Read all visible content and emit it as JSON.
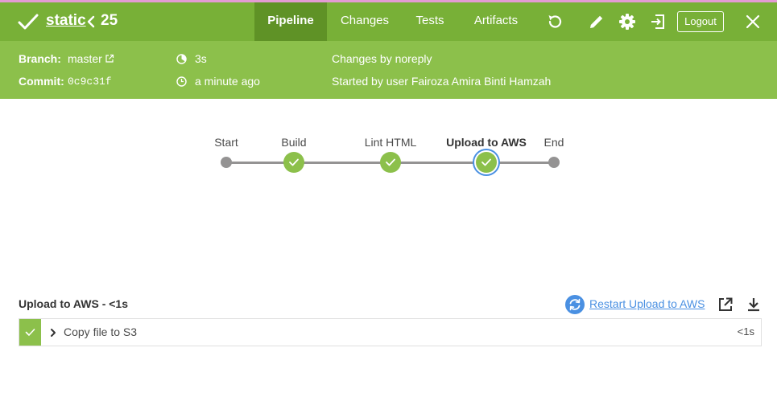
{
  "header": {
    "job_name": "static",
    "run_number": "25",
    "tabs": [
      {
        "label": "Pipeline",
        "active": true
      },
      {
        "label": "Changes",
        "active": false
      },
      {
        "label": "Tests",
        "active": false
      },
      {
        "label": "Artifacts",
        "active": false
      }
    ],
    "logout_label": "Logout",
    "icons": [
      "check-icon",
      "chevron-left-icon",
      "rerun-icon",
      "edit-icon",
      "gear-icon",
      "exit-classic-icon",
      "close-icon"
    ]
  },
  "run_info": {
    "branch_label": "Branch:",
    "branch_value": "master",
    "commit_label": "Commit:",
    "commit_value": "0c9c31f",
    "duration": "3s",
    "time_ago": "a minute ago",
    "changes": "Changes by noreply",
    "started_by": "Started by user Fairoza Amira Binti Hamzah"
  },
  "pipeline": {
    "stages": [
      {
        "label": "Start",
        "status": "none"
      },
      {
        "label": "Build",
        "status": "success"
      },
      {
        "label": "Lint HTML",
        "status": "success"
      },
      {
        "label": "Upload to AWS",
        "status": "success",
        "selected": true
      },
      {
        "label": "End",
        "status": "none"
      }
    ]
  },
  "detail": {
    "title": "Upload to AWS - <1s",
    "restart_label": "Restart Upload to AWS",
    "steps": [
      {
        "name": "Copy file to S3",
        "duration": "<1s",
        "status": "success"
      }
    ]
  },
  "colors": {
    "header_bg": "#78b037",
    "subheader_bg": "#8cc04b",
    "active_tab_bg": "#5f9226",
    "success": "#8cc04b",
    "link": "#4a90e2",
    "pipe_gray": "#949393"
  }
}
